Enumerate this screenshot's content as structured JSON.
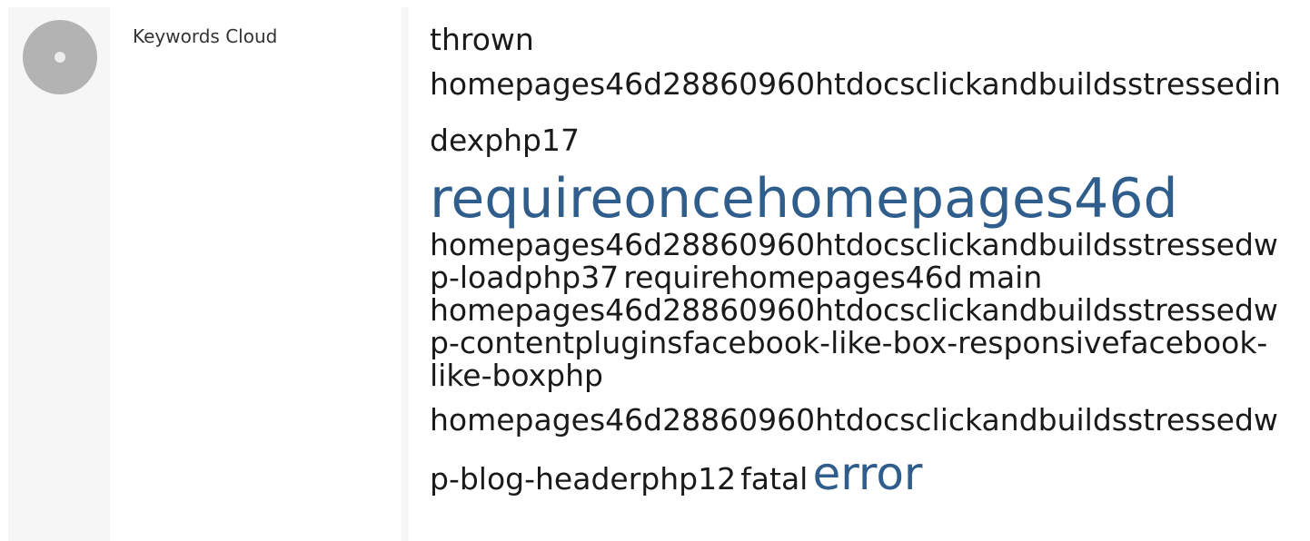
{
  "section": {
    "label": "Keywords Cloud",
    "icon": "status-circle-icon"
  },
  "colors": {
    "accent": "#2f5d8c",
    "text": "#1a1a1a",
    "panel": "#f6f6f6",
    "icon": "#b3b3b3"
  },
  "keywords": [
    {
      "text": "thrown",
      "size": "s"
    },
    {
      "text": "homepages46d28860960htdocsclickandbuildsstressedindexphp17",
      "size": "t"
    },
    {
      "text": "requireoncehomepages46d",
      "size": "big"
    },
    {
      "text": "homepages46d28860960htdocsclickandbuildsstressedwp-loadphp37",
      "size": "s"
    },
    {
      "text": "requirehomepages46d",
      "size": "s"
    },
    {
      "text": "main",
      "size": "s"
    },
    {
      "text": "homepages46d28860960htdocsclickandbuildsstressedwp-contentpluginsfacebook-like-box-responsivefacebook-like-boxphp",
      "size": "s"
    },
    {
      "text": "homepages46d28860960htdocsclickandbuildsstressedwp-blog-headerphp12",
      "size": "t"
    },
    {
      "text": "fatal",
      "size": "t"
    },
    {
      "text": "error",
      "size": "med"
    }
  ]
}
